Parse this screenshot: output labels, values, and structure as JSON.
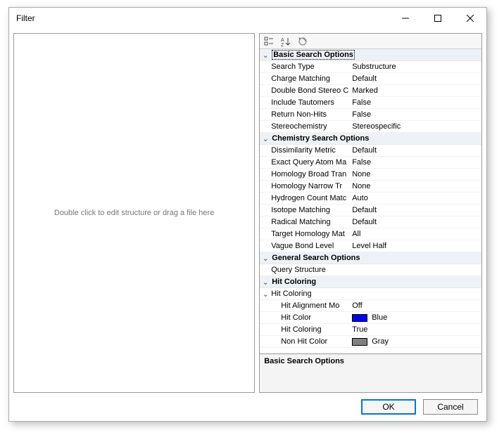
{
  "window": {
    "title": "Filter"
  },
  "left": {
    "hint": "Double click to edit structure or drag a file here"
  },
  "cats": {
    "basic": {
      "label": "Basic Search Options",
      "rows": {
        "searchType": {
          "name": "Search Type",
          "value": "Substructure"
        },
        "chargeMatch": {
          "name": "Charge Matching",
          "value": "Default"
        },
        "dblBond": {
          "name": "Double Bond Stereo C",
          "value": "Marked"
        },
        "tautomers": {
          "name": "Include Tautomers",
          "value": "False"
        },
        "retNonHits": {
          "name": "Return Non-Hits",
          "value": "False"
        },
        "stereo": {
          "name": "Stereochemistry",
          "value": "Stereospecific"
        }
      }
    },
    "chem": {
      "label": "Chemistry Search Options",
      "rows": {
        "dissim": {
          "name": "Dissimilarity Metric",
          "value": "Default"
        },
        "exactQry": {
          "name": "Exact Query Atom Ma",
          "value": "False"
        },
        "homBroad": {
          "name": "Homology Broad Tran",
          "value": "None"
        },
        "homNarrow": {
          "name": "Homology Narrow Tr",
          "value": "None"
        },
        "hcount": {
          "name": "Hydrogen Count Matc",
          "value": "Auto"
        },
        "isotope": {
          "name": "Isotope Matching",
          "value": "Default"
        },
        "radical": {
          "name": "Radical Matching",
          "value": "Default"
        },
        "targHom": {
          "name": "Target Homology Mat",
          "value": "All"
        },
        "vague": {
          "name": "Vague Bond Level",
          "value": "Level Half"
        }
      }
    },
    "general": {
      "label": "General Search Options",
      "rows": {
        "qstruct": {
          "name": "Query Structure",
          "value": ""
        }
      }
    },
    "hitcolor": {
      "label": "Hit Coloring",
      "subLabel": "Hit Coloring",
      "rows": {
        "align": {
          "name": "Hit Alignment Mo",
          "value": "Off"
        },
        "hitcol": {
          "name": "Hit Color",
          "value": "Blue",
          "chip": "#0000FF"
        },
        "hcolbool": {
          "name": "Hit Coloring",
          "value": "True"
        },
        "nonhit": {
          "name": "Non Hit Color",
          "value": "Gray",
          "chip": "#808080"
        }
      }
    }
  },
  "desc": {
    "label": "Basic Search Options"
  },
  "buttons": {
    "ok": "OK",
    "cancel": "Cancel"
  }
}
